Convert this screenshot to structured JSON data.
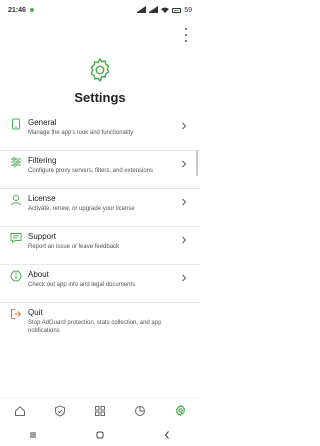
{
  "status": {
    "time": "21:46",
    "battery": "59"
  },
  "page": {
    "title": "Settings"
  },
  "menu": [
    {
      "label": "General",
      "desc": "Manage the app's look and functionality",
      "icon": "device-icon"
    },
    {
      "label": "Filtering",
      "desc": "Configure proxy servers, filters, and extensions",
      "icon": "filter-icon"
    },
    {
      "label": "License",
      "desc": "Activate, renew, or upgrade your license",
      "icon": "license-icon"
    },
    {
      "label": "Support",
      "desc": "Report an issue or leave feedback",
      "icon": "support-icon"
    },
    {
      "label": "About",
      "desc": "Check out app info and legal documents",
      "icon": "info-icon"
    },
    {
      "label": "Quit",
      "desc": "Stop AdGuard protection, stats collection, and app notifications",
      "icon": "quit-icon"
    }
  ],
  "colors": {
    "accent": "#4caf50",
    "quit": "#e07a3c"
  }
}
